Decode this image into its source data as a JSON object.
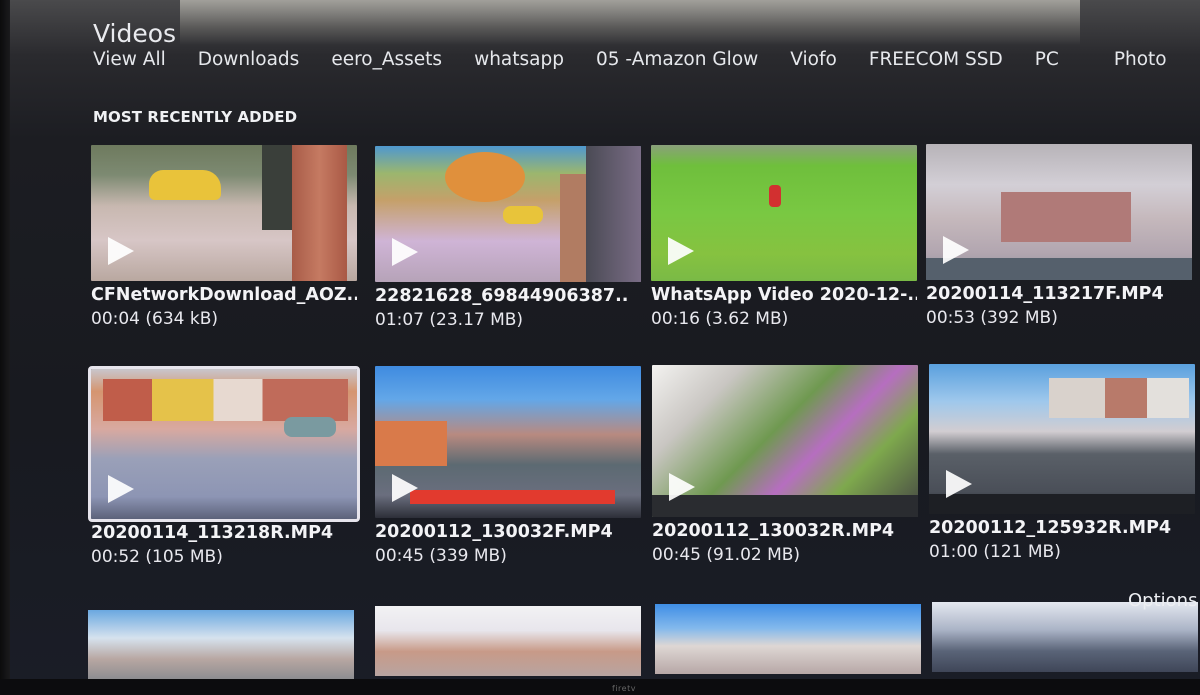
{
  "page": {
    "title": "Videos",
    "brand_label": "firetv"
  },
  "nav": {
    "items": [
      {
        "label": "View All"
      },
      {
        "label": "Downloads"
      },
      {
        "label": "eero_Assets"
      },
      {
        "label": "whatsapp"
      },
      {
        "label": "05 -Amazon Glow"
      },
      {
        "label": "Viofo"
      },
      {
        "label": "FREECOM SSD"
      },
      {
        "label": "PC"
      },
      {
        "label": "Photo"
      }
    ]
  },
  "section": {
    "label": "MOST RECENTLY ADDED"
  },
  "videos": [
    {
      "title": "CFNetworkDownload_AOZ..",
      "duration": "00:04",
      "size": "634 kB",
      "meta": "00:04 (634 kB)",
      "thumbnail": "doorstep-yellow-car"
    },
    {
      "title": "22821628_69844906387..",
      "duration": "01:07",
      "size": "23.17 MB",
      "meta": "01:07 (23.17 MB)",
      "thumbnail": "garden-autumn-tree"
    },
    {
      "title": "WhatsApp Video 2020-12-..",
      "duration": "00:16",
      "size": "3.62 MB",
      "meta": "00:16 (3.62 MB)",
      "thumbnail": "child-on-grass"
    },
    {
      "title": "20200114_113217F.MP4",
      "duration": "00:53",
      "size": "392 MB",
      "meta": "00:53 (392 MB)",
      "thumbnail": "dashcam-house-steps"
    },
    {
      "title": "20200114_113218R.MP4",
      "duration": "00:52",
      "size": "105 MB",
      "meta": "00:52 (105 MB)",
      "thumbnail": "dashcam-terraced-houses",
      "selected": true
    },
    {
      "title": "20200112_130032F.MP4",
      "duration": "00:45",
      "size": "339 MB",
      "meta": "00:45 (339 MB)",
      "thumbnail": "dashcam-street-sunny"
    },
    {
      "title": "20200112_130032R.MP4",
      "duration": "00:45",
      "size": "91.02 MB",
      "meta": "00:45 (91.02 MB)",
      "thumbnail": "dashcam-glare"
    },
    {
      "title": "20200112_125932R.MP4",
      "duration": "01:00",
      "size": "121 MB",
      "meta": "01:00 (121 MB)",
      "thumbnail": "dashcam-suburban-road"
    }
  ],
  "partial_row_thumbnails": [
    "street-sky",
    "terraced-houses",
    "houses-blue-sky",
    "trees-overcast"
  ],
  "options": {
    "label": "Options"
  },
  "icons": {
    "play": "play-icon"
  }
}
